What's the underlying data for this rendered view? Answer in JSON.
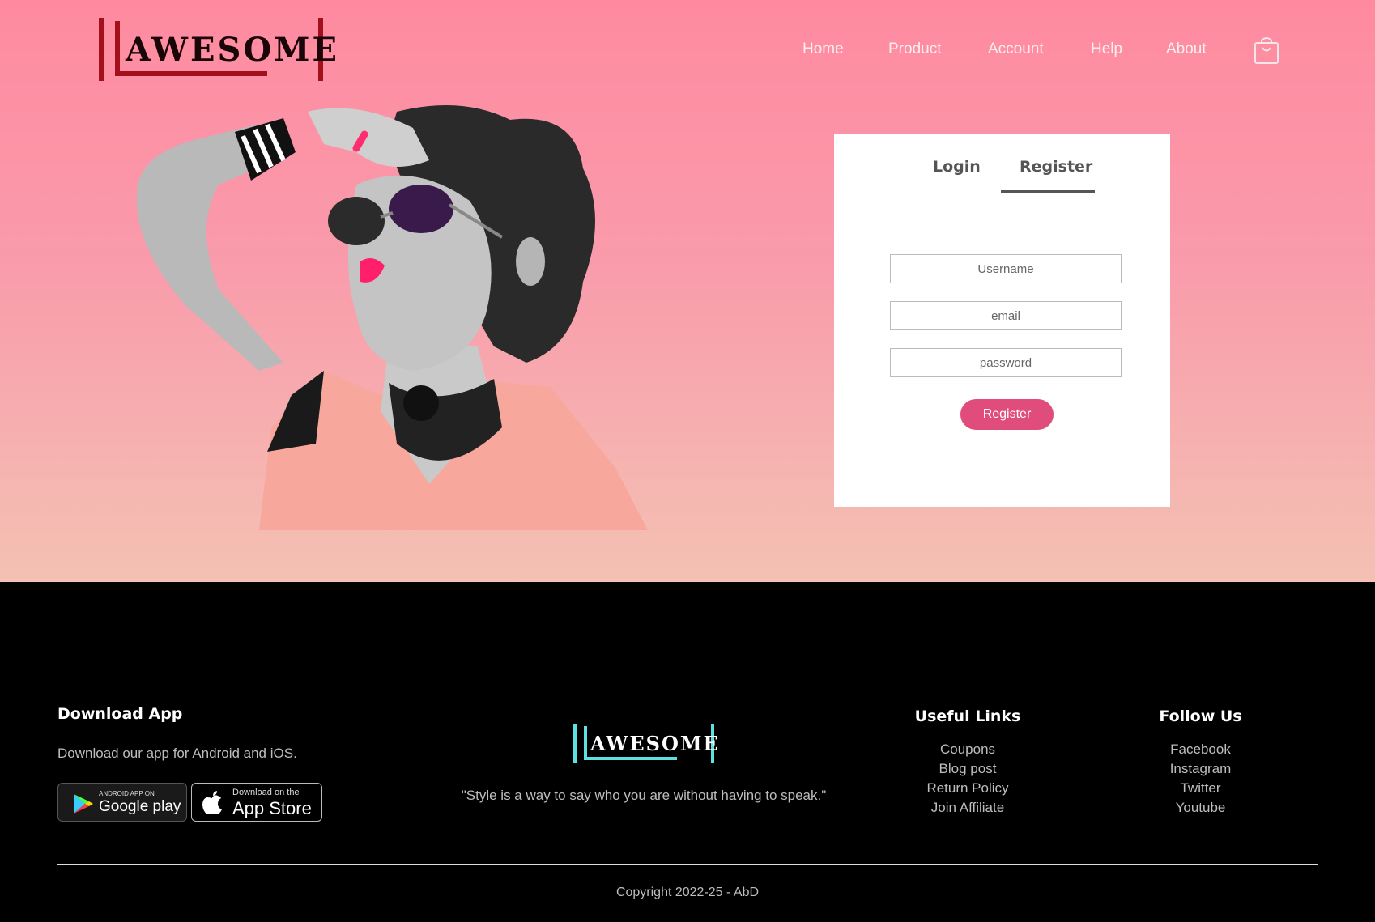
{
  "brand": {
    "logo_text": "AWESOME",
    "accent": "#a30f1a",
    "footer_accent": "#5ee0e0"
  },
  "nav": {
    "items": [
      "Home",
      "Product",
      "Account",
      "Help",
      "About"
    ],
    "cart_icon": "shopping-bag-icon"
  },
  "auth": {
    "tabs": {
      "login": "Login",
      "register": "Register",
      "active": "register"
    },
    "fields": {
      "username_placeholder": "Username",
      "email_placeholder": "email",
      "password_placeholder": "password"
    },
    "submit_label": "Register",
    "button_color": "#e04d7d"
  },
  "footer": {
    "download": {
      "heading": "Download App",
      "description": "Download our app for Android and iOS.",
      "google_small": "ANDROID APP ON",
      "google_big": "Google play",
      "apple_small": "Download on the",
      "apple_big": "App Store"
    },
    "logo_text": "AWESOME",
    "quote": "\"Style is a way to say who you are without having to speak.\"",
    "useful_links": {
      "heading": "Useful Links",
      "items": [
        "Coupons",
        "Blog post",
        "Return Policy",
        "Join Affiliate"
      ]
    },
    "follow": {
      "heading": "Follow Us",
      "items": [
        "Facebook",
        "Instagram",
        "Twitter",
        "Youtube"
      ]
    },
    "copyright": "Copyright 2022-25 - AbD"
  }
}
